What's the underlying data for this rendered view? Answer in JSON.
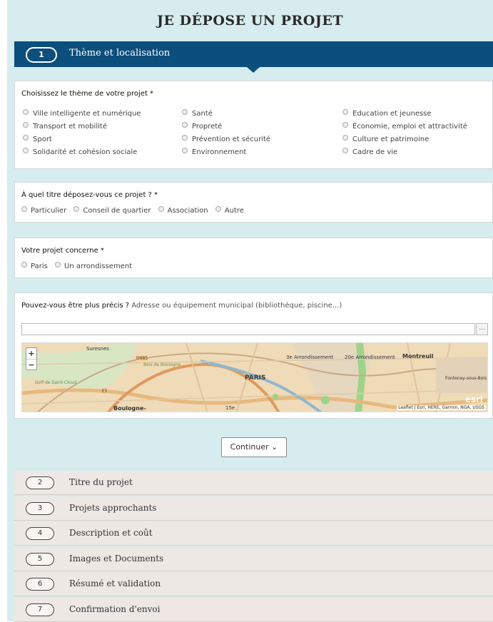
{
  "page_title": "JE DÉPOSE UN PROJET",
  "active_step": {
    "number": "1",
    "label": "Thème et localisation"
  },
  "theme": {
    "question": "Choisissez le thème de votre projet *",
    "options": [
      "Ville intelligente et numérique",
      "Santé",
      "Education et jeunesse",
      "Transport et mobilité",
      "Propreté",
      "Économie, emploi et attractivité",
      "Sport",
      "Prévention et sécurité",
      "Culture et patrimoine",
      "Solidarité et cohésion sociale",
      "Environnement",
      "Cadre de vie"
    ]
  },
  "capacity": {
    "question": "À quel titre déposez-vous ce projet ? *",
    "options": [
      "Particulier",
      "Conseil de quartier",
      "Association",
      "Autre"
    ]
  },
  "scope": {
    "question": "Votre projet concerne *",
    "options": [
      "Paris",
      "Un arrondissement"
    ]
  },
  "location": {
    "question": "Pouvez-vous être plus précis ?",
    "hint": "Adresse ou équipement municipal (bibliothèque, piscine...)",
    "address_value": "",
    "browse_label": "...",
    "map": {
      "zoom_in": "+",
      "zoom_out": "−",
      "labels": {
        "suresnes": "Suresnes",
        "bois": "Bois de Boulogne",
        "paris": "PARIS",
        "arr3": "3e Arrondissement",
        "arr20": "20e Arrondissement",
        "montreuil": "Montreuil",
        "fontenay": "Fontenay-sous-Bois",
        "boulogne": "Boulogne-",
        "arr15": "15e",
        "golf": "Golf de Saint-Cloud",
        "d985": "D985",
        "e5": "E5"
      },
      "esri": "esri",
      "attribution": "Leaflet | Esri, HERE, Garmin, NGA, USGS"
    }
  },
  "continue_label": "Continuer ⌄",
  "steps": [
    {
      "number": "2",
      "label": "Titre du projet"
    },
    {
      "number": "3",
      "label": "Projets approchants"
    },
    {
      "number": "4",
      "label": "Description et coût"
    },
    {
      "number": "5",
      "label": "Images et Documents"
    },
    {
      "number": "6",
      "label": "Résumé et validation"
    },
    {
      "number": "7",
      "label": "Confirmation d'envoi"
    }
  ],
  "colors": {
    "active_step_bg": "#0c4e7c",
    "page_bg": "#d7ecee",
    "step_bg": "#ede8e4"
  }
}
